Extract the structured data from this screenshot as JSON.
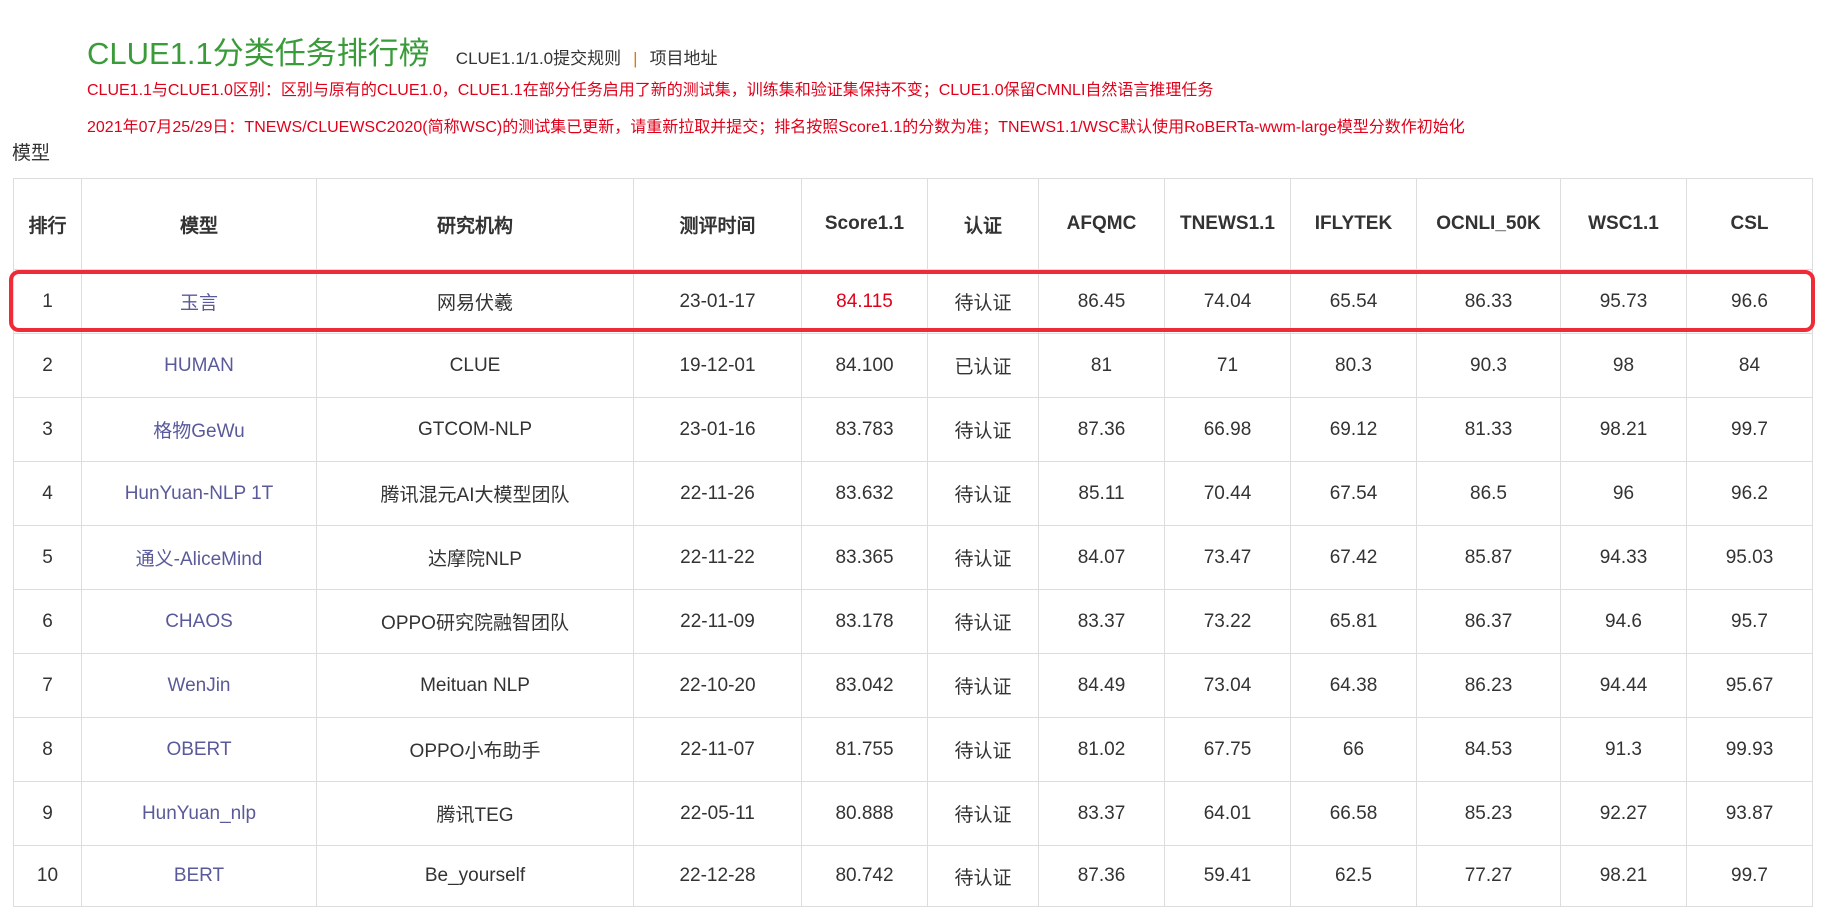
{
  "header": {
    "title": "CLUE1.1分类任务排行榜",
    "rules_link": "CLUE1.1/1.0提交规则",
    "separator": "|",
    "project_link": "项目地址"
  },
  "notices": {
    "line1": "CLUE1.1与CLUE1.0区别：区别与原有的CLUE1.0，CLUE1.1在部分任务启用了新的测试集，训练集和验证集保持不变；CLUE1.0保留CMNLI自然语言推理任务",
    "line2": "2021年07月25/29日：TNEWS/CLUEWSC2020(简称WSC)的测试集已更新，请重新拉取并提交；排名按照Score1.1的分数为准；TNEWS1.1/WSC默认使用RoBERTa-wwm-large模型分数作初始化"
  },
  "section_label": "模型",
  "table": {
    "headers": [
      "排行",
      "模型",
      "研究机构",
      "测评时间",
      "Score1.1",
      "认证",
      "AFQMC",
      "TNEWS1.1",
      "IFLYTEK",
      "OCNLI_50K",
      "WSC1.1",
      "CSL"
    ],
    "rows": [
      {
        "rank": "1",
        "model": "玉言",
        "org": "网易伏羲",
        "date": "23-01-17",
        "score": "84.115",
        "cert": "待认证",
        "afqmc": "86.45",
        "tnews": "74.04",
        "iflytek": "65.54",
        "ocnli": "86.33",
        "wsc": "95.73",
        "csl": "96.6"
      },
      {
        "rank": "2",
        "model": "HUMAN",
        "org": "CLUE",
        "date": "19-12-01",
        "score": "84.100",
        "cert": "已认证",
        "afqmc": "81",
        "tnews": "71",
        "iflytek": "80.3",
        "ocnli": "90.3",
        "wsc": "98",
        "csl": "84"
      },
      {
        "rank": "3",
        "model": "格物GeWu",
        "org": "GTCOM-NLP",
        "date": "23-01-16",
        "score": "83.783",
        "cert": "待认证",
        "afqmc": "87.36",
        "tnews": "66.98",
        "iflytek": "69.12",
        "ocnli": "81.33",
        "wsc": "98.21",
        "csl": "99.7"
      },
      {
        "rank": "4",
        "model": "HunYuan-NLP 1T",
        "org": "腾讯混元AI大模型团队",
        "date": "22-11-26",
        "score": "83.632",
        "cert": "待认证",
        "afqmc": "85.11",
        "tnews": "70.44",
        "iflytek": "67.54",
        "ocnli": "86.5",
        "wsc": "96",
        "csl": "96.2"
      },
      {
        "rank": "5",
        "model": "通义-AliceMind",
        "org": "达摩院NLP",
        "date": "22-11-22",
        "score": "83.365",
        "cert": "待认证",
        "afqmc": "84.07",
        "tnews": "73.47",
        "iflytek": "67.42",
        "ocnli": "85.87",
        "wsc": "94.33",
        "csl": "95.03"
      },
      {
        "rank": "6",
        "model": "CHAOS",
        "org": "OPPO研究院融智团队",
        "date": "22-11-09",
        "score": "83.178",
        "cert": "待认证",
        "afqmc": "83.37",
        "tnews": "73.22",
        "iflytek": "65.81",
        "ocnli": "86.37",
        "wsc": "94.6",
        "csl": "95.7"
      },
      {
        "rank": "7",
        "model": "WenJin",
        "org": "Meituan NLP",
        "date": "22-10-20",
        "score": "83.042",
        "cert": "待认证",
        "afqmc": "84.49",
        "tnews": "73.04",
        "iflytek": "64.38",
        "ocnli": "86.23",
        "wsc": "94.44",
        "csl": "95.67"
      },
      {
        "rank": "8",
        "model": "OBERT",
        "org": "OPPO小布助手",
        "date": "22-11-07",
        "score": "81.755",
        "cert": "待认证",
        "afqmc": "81.02",
        "tnews": "67.75",
        "iflytek": "66",
        "ocnli": "84.53",
        "wsc": "91.3",
        "csl": "99.93"
      },
      {
        "rank": "9",
        "model": "HunYuan_nlp",
        "org": "腾讯TEG",
        "date": "22-05-11",
        "score": "80.888",
        "cert": "待认证",
        "afqmc": "83.37",
        "tnews": "64.01",
        "iflytek": "66.58",
        "ocnli": "85.23",
        "wsc": "92.27",
        "csl": "93.87"
      },
      {
        "rank": "10",
        "model": "BERT",
        "org": "Be_yourself",
        "date": "22-12-28",
        "score": "80.742",
        "cert": "待认证",
        "afqmc": "87.36",
        "tnews": "59.41",
        "iflytek": "62.5",
        "ocnli": "77.27",
        "wsc": "98.21",
        "csl": "99.7"
      }
    ]
  },
  "colors": {
    "title_green": "#3a9b3a",
    "notice_red": "#e0001a",
    "model_link": "#5a5a9a",
    "highlight_border": "#ef2b37"
  }
}
